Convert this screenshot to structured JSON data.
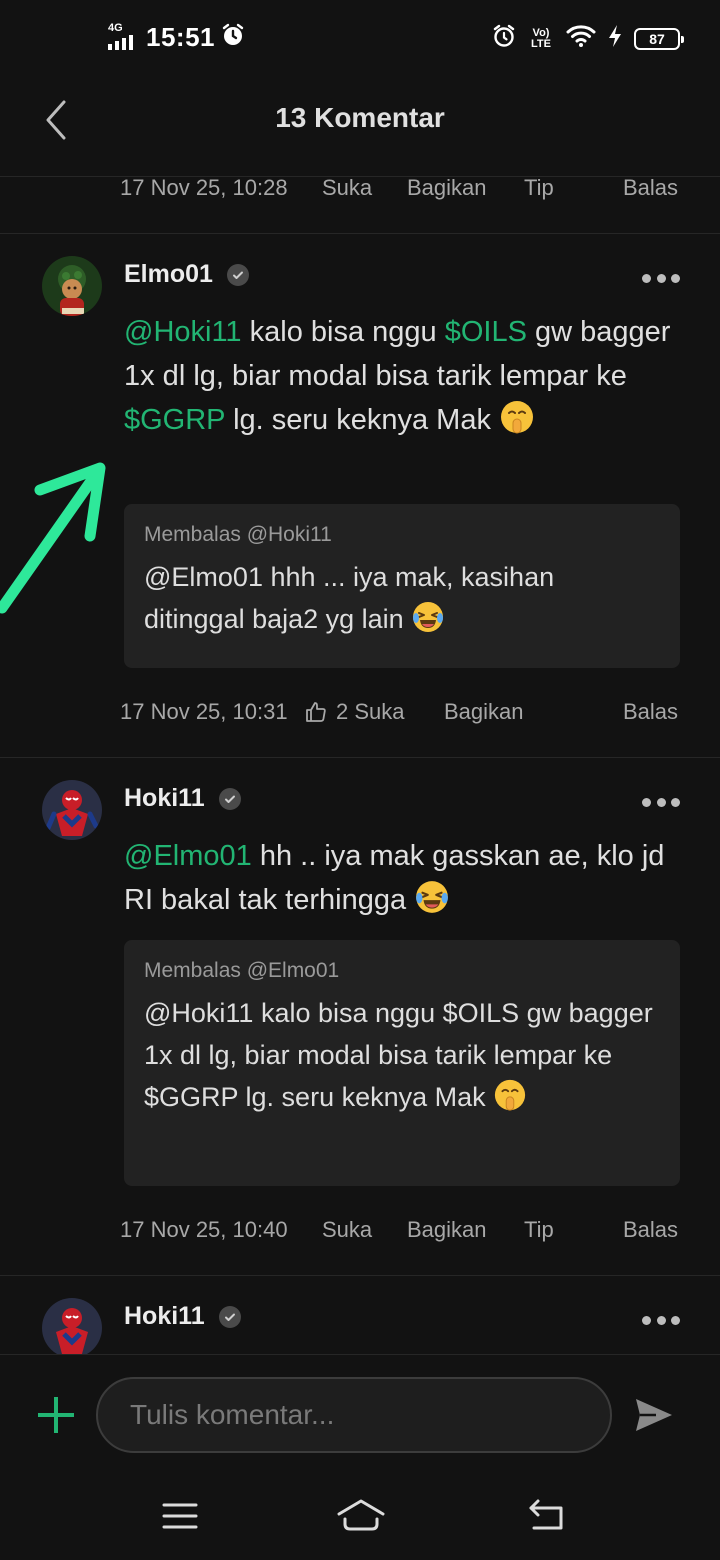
{
  "status_bar": {
    "network": "4G",
    "time": "15:51",
    "volte": "Vo) LTE",
    "battery": "87"
  },
  "header": {
    "title": "13 Komentar"
  },
  "top_meta": {
    "date": "17 Nov 25, 10:28",
    "like": "Suka",
    "share": "Bagikan",
    "tip": "Tip",
    "reply": "Balas"
  },
  "comments": [
    {
      "username": "Elmo01",
      "mention": "@Hoki11",
      "text_1": " kalo bisa nggu ",
      "ticker_1": "$OILS",
      "text_2": " gw bagger 1x dl lg, biar modal bisa tarik lempar ke  ",
      "ticker_2": "$GGRP",
      "text_3": " lg. seru keknya Mak ",
      "emoji": "shushing-face",
      "quote_header": "Membalas @Hoki11",
      "quote_body": "@Elmo01 hhh ... iya mak, kasihan ditinggal baja2 yg lain ",
      "quote_emoji": "laughing-tears-face",
      "date": "17 Nov 25, 10:31",
      "likes": "2 Suka",
      "share": "Bagikan",
      "reply": "Balas"
    },
    {
      "username": "Hoki11",
      "mention": "@Elmo01",
      "text_1": " hh .. iya mak gasskan ae, klo jd RI bakal tak terhingga ",
      "emoji": "laughing-tears-face",
      "quote_header": "Membalas @Elmo01",
      "quote_body": "@Hoki11 kalo bisa nggu $OILS gw bagger 1x dl lg, biar modal bisa tarik lempar ke  $GGRP lg. seru keknya Mak ",
      "quote_emoji": "shushing-face",
      "date": "17 Nov 25, 10:40",
      "like": "Suka",
      "share": "Bagikan",
      "tip": "Tip",
      "reply": "Balas"
    },
    {
      "username": "Hoki11"
    }
  ],
  "composer": {
    "placeholder": "Tulis komentar..."
  },
  "colors": {
    "accent": "#22b573",
    "background": "#121212",
    "arrow": "#2ee89a"
  }
}
